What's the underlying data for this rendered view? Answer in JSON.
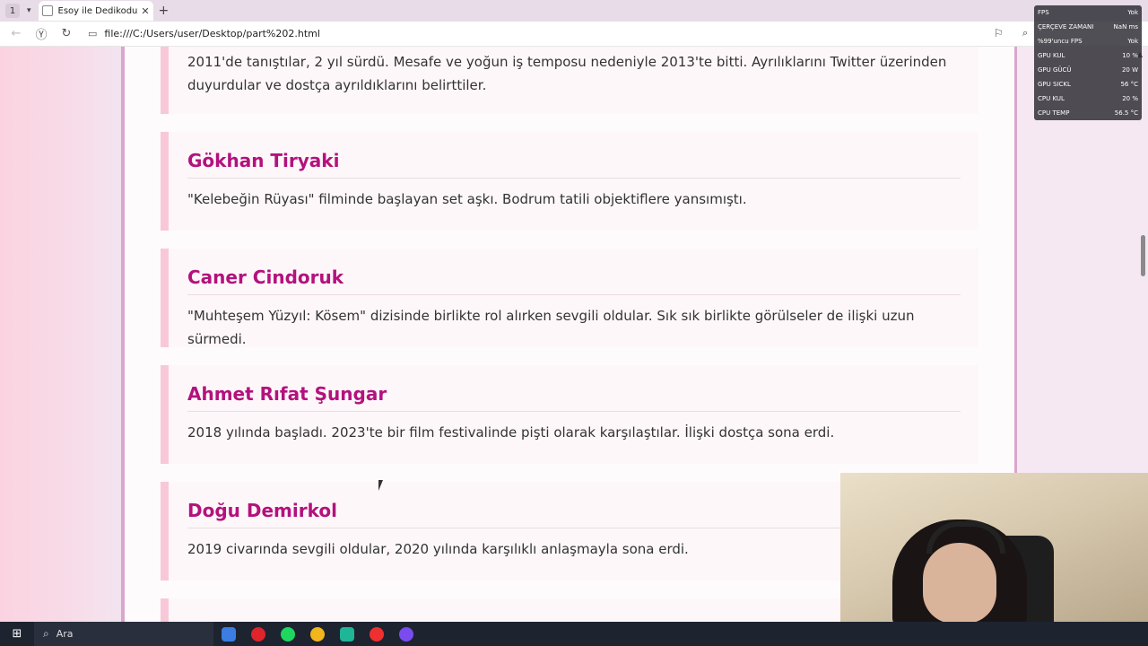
{
  "browser": {
    "tab_count": "1",
    "tab_title": "Esoy ile Dedikodu Köşe",
    "url": "file:///C:/Users/user/Desktop/part%202.html"
  },
  "intro_text": "2011'de tanıştılar, 2 yıl sürdü. Mesafe ve yoğun iş temposu nedeniyle 2013'te bitti. Ayrılıklarını Twitter üzerinden duyurdular ve dostça ayrıldıklarını belirttiler.",
  "entries": [
    {
      "name": "Gökhan Tiryaki",
      "text": "\"Kelebeğin Rüyası\" filminde başlayan set aşkı. Bodrum tatili objektiflere yansımıştı."
    },
    {
      "name": "Caner Cindoruk",
      "text": "\"Muhteşem Yüzyıl: Kösem\" dizisinde birlikte rol alırken sevgili oldular. Sık sık birlikte görülseler de ilişki uzun sürmedi."
    },
    {
      "name": "Ahmet Rıfat Şungar",
      "text": "2018 yılında başladı. 2023'te bir film festivalinde pişti olarak karşılaştılar. İlişki dostça sona erdi."
    },
    {
      "name": "Doğu Demirkol",
      "text": "2019 civarında sevgili oldular, 2020 yılında karşılıklı anlaşmayla sona erdi."
    }
  ],
  "perf_overlay": [
    {
      "label": "FPS",
      "value": "Yok"
    },
    {
      "label": "ÇERÇEVE ZAMANI",
      "value": "NaN ms"
    },
    {
      "label": "%99'uncu FPS",
      "value": "Yok"
    },
    {
      "label": "GPU KUL",
      "value": "10 %"
    },
    {
      "label": "GPU GÜCÜ",
      "value": "20 W"
    },
    {
      "label": "GPU SICKL",
      "value": "56 °C"
    },
    {
      "label": "CPU KUL",
      "value": "20 %"
    },
    {
      "label": "CPU TEMP",
      "value": "56.5 °C"
    }
  ],
  "taskbar": {
    "search_label": "Ara",
    "apps": [
      {
        "icon": "store-icon",
        "color": "#3b7de0"
      },
      {
        "icon": "opera-icon",
        "color": "#e0242b"
      },
      {
        "icon": "spotify-icon",
        "color": "#1ed760"
      },
      {
        "icon": "chrome-icon",
        "color": "#f1b61c"
      },
      {
        "icon": "app-icon",
        "color": "#1fb597"
      },
      {
        "icon": "yandex-icon",
        "color": "#f03030"
      },
      {
        "icon": "messenger-icon",
        "color": "#7a4cf0"
      }
    ]
  },
  "colors": {
    "heading": "#b3127d",
    "card_border": "#f9c8d8",
    "page_border": "#d9a6cc"
  }
}
